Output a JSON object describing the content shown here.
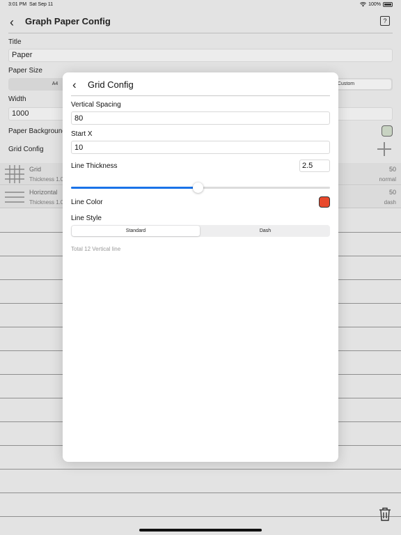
{
  "status": {
    "time": "3:01 PM",
    "date": "Sat Sep 11",
    "battery": "100%"
  },
  "nav": {
    "title": "Graph Paper Config",
    "help": "?"
  },
  "background": {
    "title_label": "Title",
    "title_value": "Paper",
    "paper_size_label": "Paper Size",
    "paper_size_options": [
      "A4",
      "Custom"
    ],
    "width_label": "Width",
    "width_value": "1000",
    "paper_background_label": "Paper Background",
    "paper_background_color": "#c8d3c2",
    "grid_config_label": "Grid Config",
    "grids": [
      {
        "name": "Grid",
        "thickness": "Thickness 1.0",
        "spacing": "50",
        "style": "normal"
      },
      {
        "name": "Horizontal",
        "thickness": "Thickness 1.0",
        "spacing": "50",
        "style": "dash"
      }
    ]
  },
  "modal": {
    "title": "Grid Config",
    "vertical_spacing_label": "Vertical Spacing",
    "vertical_spacing_value": "80",
    "start_x_label": "Start X",
    "start_x_value": "10",
    "line_thickness_label": "Line Thickness",
    "line_thickness_value": "2.5",
    "line_thickness_fraction": 0.49,
    "line_color_label": "Line Color",
    "line_color": "#e8492c",
    "line_style_label": "Line Style",
    "line_style_options": [
      "Standard",
      "Dash"
    ],
    "line_style_selected": "Standard",
    "total_text": "Total 12 Vertical line"
  },
  "colors": {
    "accent": "#1a73e8"
  }
}
